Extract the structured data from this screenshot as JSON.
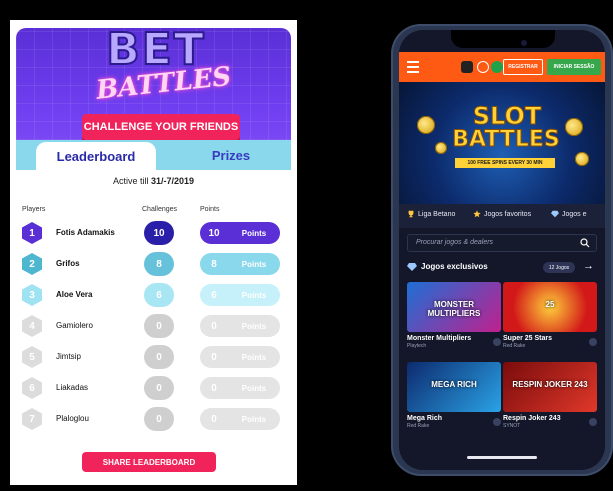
{
  "left_panel": {
    "logo_top": "BET",
    "logo_bottom": "BATTLES",
    "challenge_button": "CHALLENGE YOUR FRIENDS",
    "tabs": [
      {
        "label": "Leaderboard"
      },
      {
        "label": "Prizes"
      }
    ],
    "active_till_label": "Active till",
    "active_till_date": "31/-7/2019",
    "columns": {
      "players": "Players",
      "challenges": "Challenges",
      "points": "Points"
    },
    "rows": [
      {
        "rank": "1",
        "name": "Fotis Adamakis",
        "challenges": "10",
        "points": "10",
        "points_label": "Points",
        "hex_color": "#5a2fd6",
        "circ_color": "#2a1fa8",
        "pill_color": "#5a2fd6"
      },
      {
        "rank": "2",
        "name": "Grifos",
        "challenges": "8",
        "points": "8",
        "points_label": "Points",
        "hex_color": "#4fb6cf",
        "circ_color": "#66c2da",
        "pill_color": "#8ad8ec"
      },
      {
        "rank": "3",
        "name": "Aloe Vera",
        "challenges": "6",
        "points": "6",
        "points_label": "Points",
        "hex_color": "#9fe3f2",
        "circ_color": "#a8e6f4",
        "pill_color": "#c6f0fa"
      },
      {
        "rank": "4",
        "name": "Gamiolero",
        "challenges": "0",
        "points": "0",
        "points_label": "Points",
        "hex_color": "#dcdcdc",
        "circ_color": "#cfcfcf",
        "pill_color": "#e4e4e4"
      },
      {
        "rank": "5",
        "name": "Jimtsip",
        "challenges": "0",
        "points": "0",
        "points_label": "Points",
        "hex_color": "#dcdcdc",
        "circ_color": "#cfcfcf",
        "pill_color": "#e4e4e4"
      },
      {
        "rank": "6",
        "name": "Liakadas",
        "challenges": "0",
        "points": "0",
        "points_label": "Points",
        "hex_color": "#dcdcdc",
        "circ_color": "#cfcfcf",
        "pill_color": "#e4e4e4"
      },
      {
        "rank": "7",
        "name": "Plaloglou",
        "challenges": "0",
        "points": "0",
        "points_label": "Points",
        "hex_color": "#dcdcdc",
        "circ_color": "#cfcfcf",
        "pill_color": "#e4e4e4"
      }
    ],
    "share_button": "SHARE LEADERBOARD"
  },
  "phone": {
    "register_button": "REGISTRAR",
    "login_button": "INICIAR SESSÃO",
    "banner_line1": "SLOT",
    "banner_line2": "BATTLES",
    "banner_tag": "100 FREE SPINS EVERY 30 MIN",
    "favbar": [
      {
        "label": "Liga Betano",
        "icon": "trophy-icon"
      },
      {
        "label": "Jogos favoritos",
        "icon": "star-icon"
      },
      {
        "label": "Jogos e",
        "icon": "diamond-icon"
      }
    ],
    "search_placeholder": "Procurar jogos & dealers",
    "section_title": "Jogos exclusivos",
    "section_badge": "12 Jogos",
    "games": [
      {
        "title": "Monster Multipliers",
        "provider": "Playtech",
        "thumb_text": "MONSTER MULTIPLIERS",
        "bg": "linear-gradient(135deg,#1d6fd6,#c0208e)"
      },
      {
        "title": "Super 25 Stars",
        "provider": "Red Rake",
        "thumb_text": "25",
        "bg": "radial-gradient(circle,#ffcf3a,#d21818 70%)"
      },
      {
        "title": "Mega Rich",
        "provider": "Red Rake",
        "thumb_text": "MEGA RICH",
        "bg": "linear-gradient(135deg,#0d2a6e,#2aa3e6)"
      },
      {
        "title": "Respin Joker 243",
        "provider": "SYNOT",
        "thumb_text": "RESPIN JOKER 243",
        "bg": "linear-gradient(135deg,#7a0c0c,#e0382a)"
      }
    ]
  }
}
